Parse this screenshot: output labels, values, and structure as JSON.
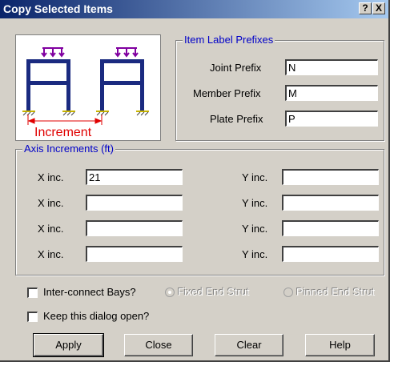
{
  "window": {
    "title": "Copy Selected Items",
    "help_label": "?",
    "close_label": "X"
  },
  "picture": {
    "label": "Increment"
  },
  "prefixes": {
    "legend": "Item Label Prefixes",
    "joint": {
      "label": "Joint Prefix",
      "value": "N"
    },
    "member": {
      "label": "Member Prefix",
      "value": "M"
    },
    "plate": {
      "label": "Plate Prefix",
      "value": "P"
    }
  },
  "axis": {
    "legend": "Axis Increments  (ft)",
    "x_label": "X inc.",
    "y_label": "Y inc.",
    "rows": [
      {
        "x": "21",
        "y": ""
      },
      {
        "x": "",
        "y": ""
      },
      {
        "x": "",
        "y": ""
      },
      {
        "x": "",
        "y": ""
      }
    ]
  },
  "options": {
    "interconnect": {
      "label": "Inter-connect Bays?",
      "checked": false
    },
    "fixed_end_strut": {
      "label": "Fixed End Strut",
      "selected": true
    },
    "pinned_end_strut": {
      "label": "Pinned End Strut",
      "selected": false
    },
    "keep_open": {
      "label": "Keep this dialog open?",
      "checked": false
    }
  },
  "buttons": {
    "apply": "Apply",
    "close": "Close",
    "clear": "Clear",
    "help": "Help"
  },
  "colors": {
    "title_gradient_start": "#0a246a",
    "title_gradient_end": "#a6caf0",
    "legend_text": "#0000c8",
    "frame": "#1a2a80",
    "load": "#8000a0",
    "support": "#c8b400",
    "dimension": "#e00000"
  }
}
